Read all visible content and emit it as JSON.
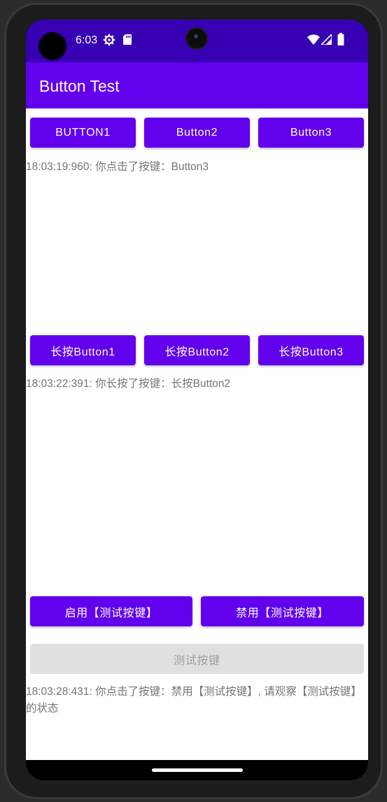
{
  "status_bar": {
    "time": "6:03",
    "left_icons": [
      "settings-gear-icon",
      "sd-card-icon"
    ],
    "right_icons": [
      "wifi-icon",
      "signal-icon",
      "battery-icon"
    ]
  },
  "toolbar": {
    "title": "Button Test"
  },
  "colors": {
    "primary": "#6200ee",
    "primary_dark": "#3700b3",
    "disabled_bg": "#e0e0e0",
    "disabled_text": "#9e9e9e",
    "log_text": "#757575"
  },
  "click_buttons": {
    "button1": "BUTTON1",
    "button2": "Button2",
    "button3": "Button3"
  },
  "click_log": "18:03:19:960: 你点击了按键：Button3",
  "long_press_buttons": {
    "button1": "长按Button1",
    "button2": "长按Button2",
    "button3": "长按Button3"
  },
  "long_press_log": "18:03:22:391: 你长按了按键：长按Button2",
  "toggle_buttons": {
    "enable": "启用【测试按键】",
    "disable": "禁用【测试按键】"
  },
  "test_button": {
    "label": "测试按键",
    "enabled": false
  },
  "test_log": "18:03:28:431: 你点击了按键：禁用【测试按键】, 请观察【测试按键】的状态"
}
